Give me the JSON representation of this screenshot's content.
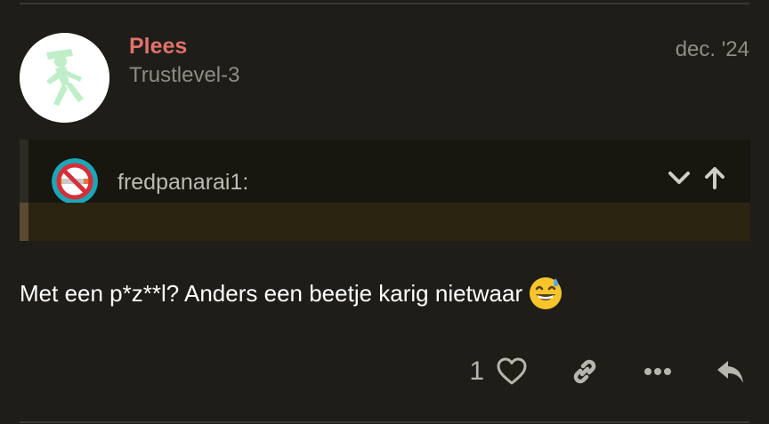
{
  "post": {
    "username": "Plees",
    "user_title": "Trustlevel-3",
    "date": "dec. '24",
    "avatar_icon": "pedestrian-traffic-light-icon",
    "quote": {
      "username": "fredpanarai1:",
      "avatar_icon": "no-smoking-icon",
      "expand_icon": "chevron-down-icon",
      "jump_icon": "arrow-up-icon"
    },
    "text": "Met een p*z**l? Anders een beetje karig nietwaar",
    "emoji": "grinning-face-with-sweat-emoji",
    "actions": {
      "like_count": "1",
      "like_icon": "heart-icon",
      "link_icon": "link-icon",
      "more_icon": "ellipsis-icon",
      "reply_icon": "reply-icon"
    }
  },
  "colors": {
    "background": "#1f1d18",
    "username": "#e0726b",
    "muted_text": "#8e8c85",
    "quote_bg": "#17160f",
    "quote_body_bg": "#2b2411"
  }
}
